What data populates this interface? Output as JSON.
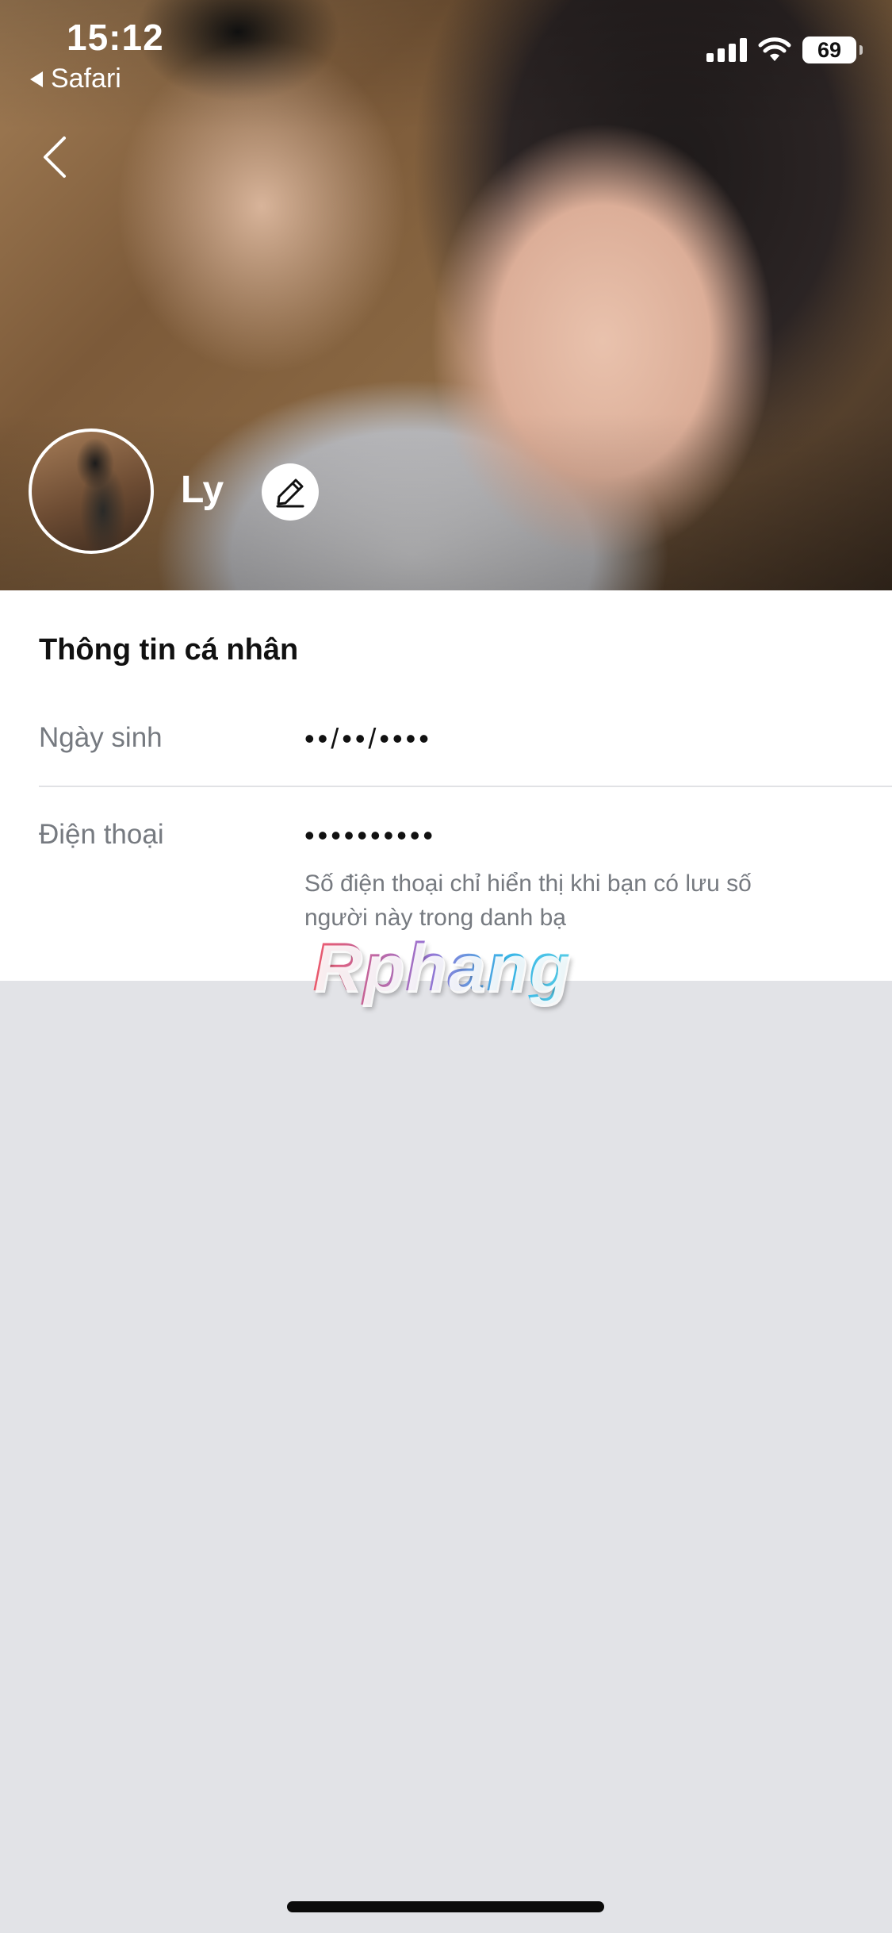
{
  "status_bar": {
    "time": "15:12",
    "back_app": "Safari",
    "battery": "69"
  },
  "profile": {
    "name": "Ly"
  },
  "info": {
    "section_title": "Thông tin cá nhân",
    "birthday_label": "Ngày sinh",
    "birthday_value": "••/••/••••",
    "phone_label": "Điện thoại",
    "phone_value": "••••••••••",
    "phone_note": "Số điện thoại chỉ hiển thị khi bạn có lưu số người này trong danh bạ"
  },
  "watermark": "Rphang",
  "icons": {
    "back": "chevron-left-icon",
    "edit": "pencil-icon",
    "signal": "cellular-signal-icon",
    "wifi": "wifi-icon",
    "battery": "battery-icon"
  }
}
